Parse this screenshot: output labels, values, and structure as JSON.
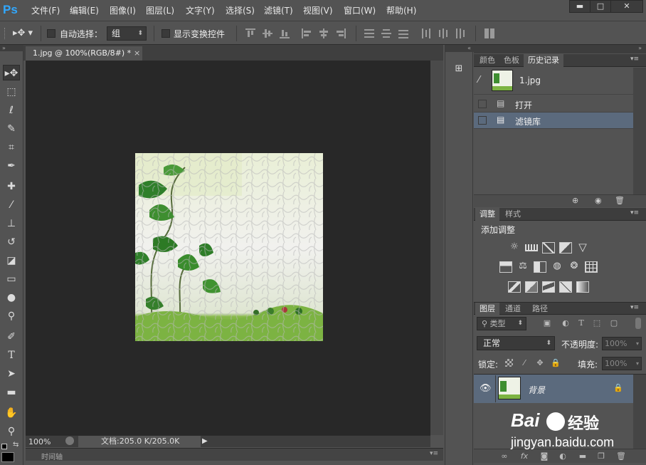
{
  "app": {
    "logo": "Ps"
  },
  "menu": [
    "文件(F)",
    "编辑(E)",
    "图像(I)",
    "图层(L)",
    "文字(Y)",
    "选择(S)",
    "滤镜(T)",
    "视图(V)",
    "窗口(W)",
    "帮助(H)"
  ],
  "window_controls": {
    "minimize": "▬",
    "maximize": "□",
    "close": "✕"
  },
  "options": {
    "auto_select_label": "自动选择：",
    "auto_select_value": "组",
    "show_transform_label": "显示变换控件"
  },
  "document": {
    "tab_title": "1.jpg @ 100%(RGB/8#) *",
    "tab_close": "×",
    "zoom": "100%",
    "doc_info": "文档:205.0 K/205.0K"
  },
  "timeline": {
    "label": "时间轴"
  },
  "history_panel": {
    "tabs": [
      "颜色",
      "色板",
      "历史记录"
    ],
    "active_tab": "历史记录",
    "snapshot_name": "1.jpg",
    "items": [
      "打开",
      "滤镜库"
    ],
    "selected_item": "滤镜库"
  },
  "adjustments_panel": {
    "tabs": [
      "调整",
      "样式"
    ],
    "active_tab": "调整",
    "title": "添加调整"
  },
  "layers_panel": {
    "tabs": [
      "图层",
      "通道",
      "路径"
    ],
    "active_tab": "图层",
    "filter_kind": "类型",
    "blend_mode": "正常",
    "opacity_label": "不透明度:",
    "opacity_value": "100%",
    "lock_label": "锁定:",
    "fill_label": "填充:",
    "fill_value": "100%",
    "layers": [
      {
        "name": "背景",
        "locked": true,
        "visible": true
      }
    ],
    "footer_icons": [
      "link-icon",
      "fx-icon",
      "mask-icon",
      "adjustment-layer-icon",
      "group-folder-icon",
      "new-layer-icon",
      "delete-icon"
    ]
  },
  "watermark": {
    "brand": "Bai",
    "brand_tail": "经验",
    "url": "jingyan.baidu.com"
  },
  "colors": {
    "ui_bg": "#535353",
    "canvas_bg": "#282828",
    "selected_row": "#5b6a7d",
    "ps_blue": "#31a8ff"
  }
}
